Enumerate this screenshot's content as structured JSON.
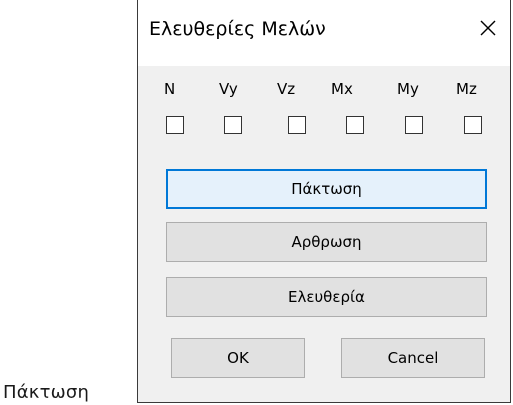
{
  "background_caption": "Πάκτωση",
  "dialog": {
    "title": "Ελευθερίες Μελών",
    "close_icon": "close-icon",
    "dof_labels": [
      "N",
      "Vy",
      "Vz",
      "Mx",
      "My",
      "Mz"
    ],
    "dof_checked": [
      false,
      false,
      false,
      false,
      false,
      false
    ],
    "buttons": {
      "fixed": "Πάκτωση",
      "hinged": "Αρθρωση",
      "free": "Ελευθερία",
      "ok": "OK",
      "cancel": "Cancel"
    },
    "accent_color": "#0078d7"
  }
}
